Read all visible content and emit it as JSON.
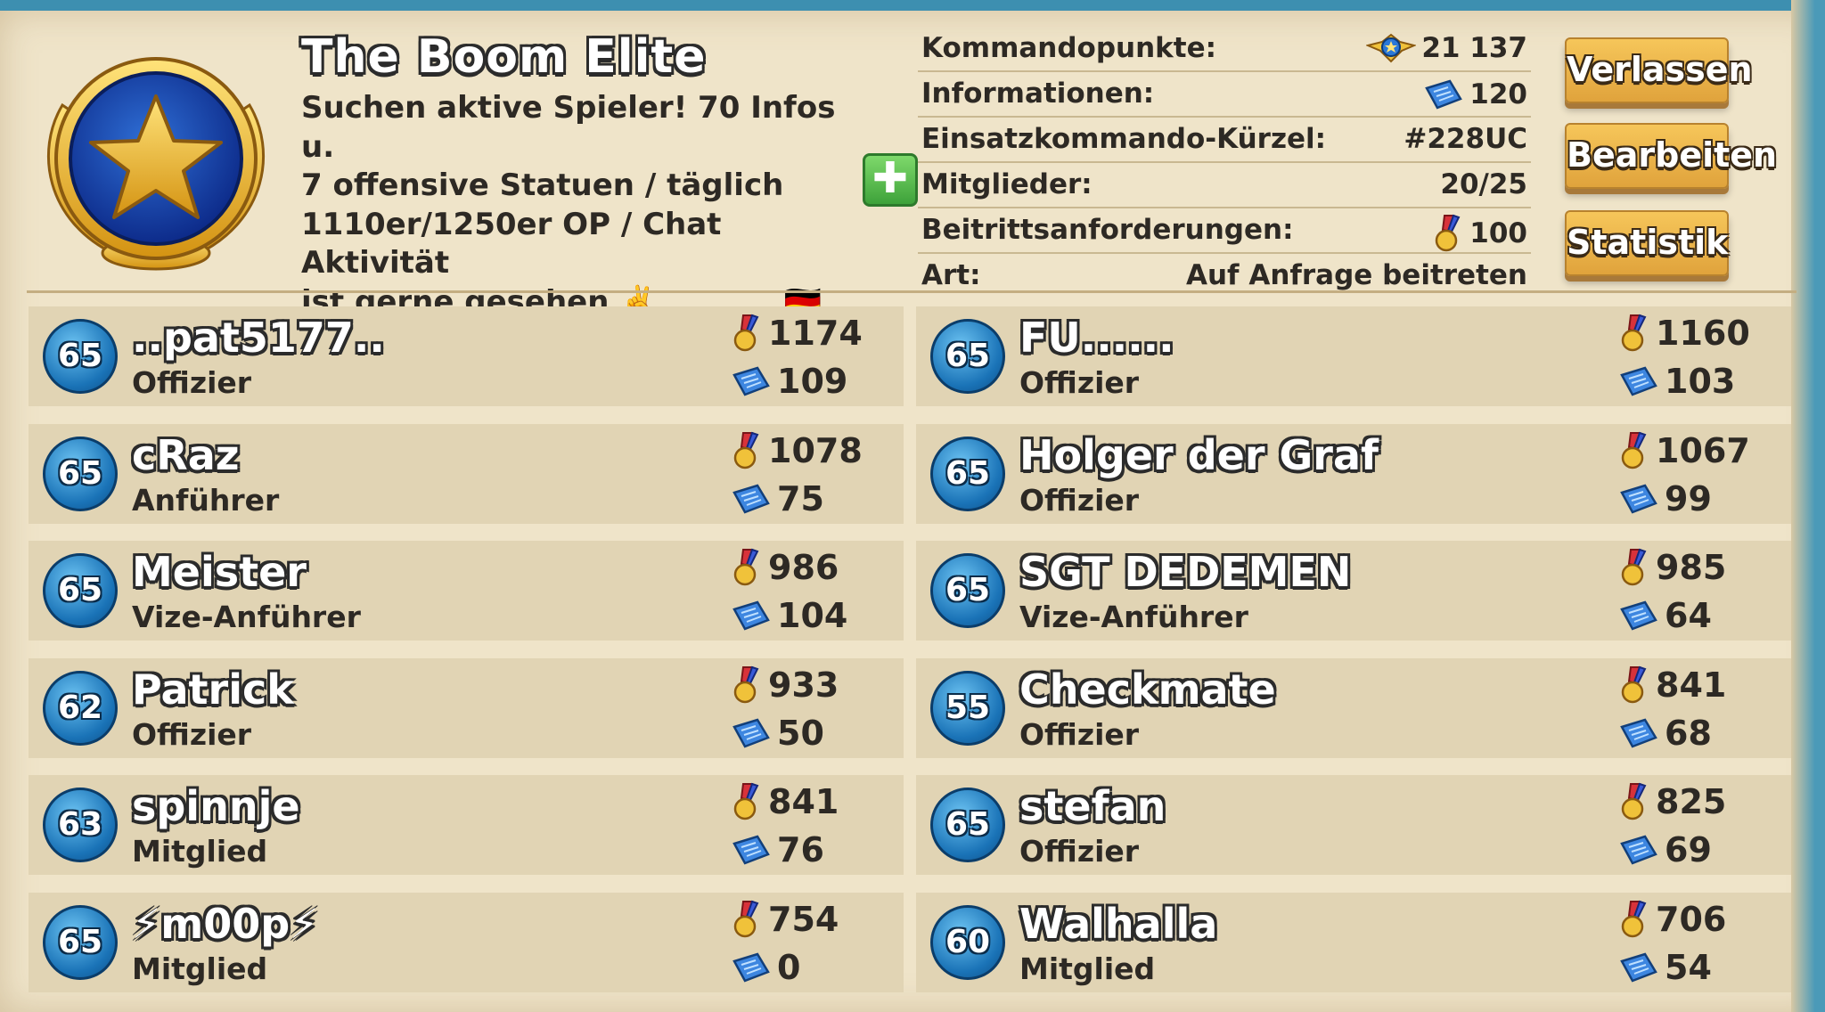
{
  "clan": {
    "name": "The Boom Elite",
    "description": "Suchen aktive Spieler! 70 Infos u.\n7 offensive Statuen / täglich\n1110er/1250er OP / Chat Aktivität\nist gerne gesehen ✌️            🇩🇪"
  },
  "info": [
    {
      "label": "Kommandopunkte:",
      "value": "21 137",
      "icon": "command-points-icon"
    },
    {
      "label": "Informationen:",
      "value": "120",
      "icon": "intel-icon"
    },
    {
      "label": "Einsatzkommando-Kürzel:",
      "value": "#228UC",
      "icon": ""
    },
    {
      "label": "Mitglieder:",
      "value": "20/25",
      "icon": ""
    },
    {
      "label": "Beitrittsanforderungen:",
      "value": "100",
      "icon": "medal-icon"
    },
    {
      "label": "Art:",
      "value": "Auf Anfrage beitreten",
      "icon": ""
    }
  ],
  "buttons": {
    "leave": "Verlassen",
    "edit": "Bearbeiten",
    "stats": "Statistik",
    "add": "✚"
  },
  "members": [
    {
      "level": "65",
      "name": "..pat5177..",
      "role": "Offizier",
      "medals": "1174",
      "intel": "109"
    },
    {
      "level": "65",
      "name": "FU......",
      "role": "Offizier",
      "medals": "1160",
      "intel": "103"
    },
    {
      "level": "65",
      "name": "cRaz",
      "role": "Anführer",
      "medals": "1078",
      "intel": "75"
    },
    {
      "level": "65",
      "name": "Holger der Graf",
      "role": "Offizier",
      "medals": "1067",
      "intel": "99"
    },
    {
      "level": "65",
      "name": "Meister",
      "role": "Vize-Anführer",
      "medals": "986",
      "intel": "104"
    },
    {
      "level": "65",
      "name": "SGT DEDEMEN",
      "role": "Vize-Anführer",
      "medals": "985",
      "intel": "64"
    },
    {
      "level": "62",
      "name": "Patrick",
      "role": "Offizier",
      "medals": "933",
      "intel": "50"
    },
    {
      "level": "55",
      "name": "Checkmate",
      "role": "Offizier",
      "medals": "841",
      "intel": "68"
    },
    {
      "level": "63",
      "name": "spinnje",
      "role": "Mitglied",
      "medals": "841",
      "intel": "76"
    },
    {
      "level": "65",
      "name": "stefan",
      "role": "Offizier",
      "medals": "825",
      "intel": "69"
    },
    {
      "level": "65",
      "name": "⚡m00p⚡",
      "role": "Mitglied",
      "medals": "754",
      "intel": "0"
    },
    {
      "level": "60",
      "name": "Walhalla",
      "role": "Mitglied",
      "medals": "706",
      "intel": "54"
    }
  ],
  "colors": {
    "panel": "#efe4c9",
    "row": "#e1d4b4",
    "button": "#f0b54a",
    "level_badge": "#1a73b7",
    "text": "#2d2924"
  }
}
